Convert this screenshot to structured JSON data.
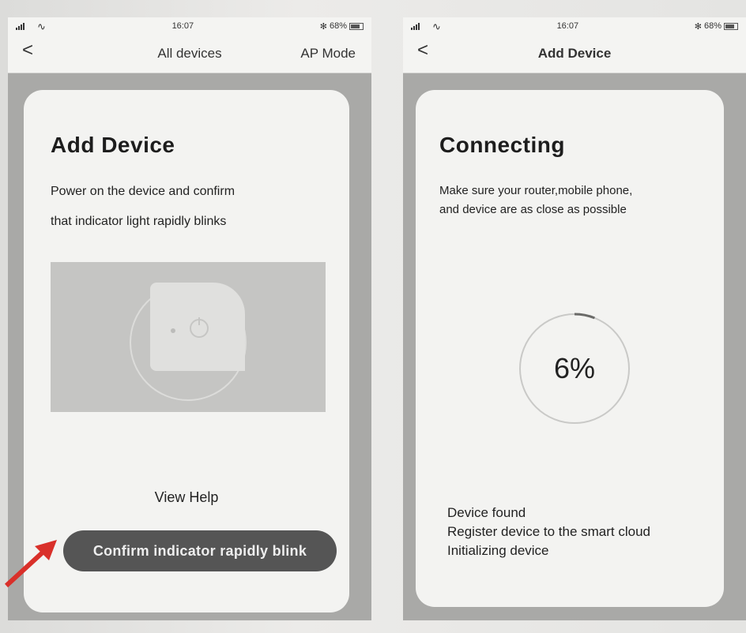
{
  "left_screen": {
    "status": {
      "time": "16:07",
      "battery": "68%"
    },
    "nav": {
      "back_label": "<",
      "title": "All devices",
      "right_action": "AP Mode"
    },
    "card": {
      "title": "Add Device",
      "description_line1": "Power on the device and confirm",
      "description_line2": "that indicator light rapidly blinks",
      "help_label": "View Help",
      "confirm_label": "Confirm indicator rapidly blink"
    }
  },
  "right_screen": {
    "status": {
      "time": "16:07",
      "battery": "68%"
    },
    "nav": {
      "back_label": "<",
      "title": "Add Device"
    },
    "card": {
      "title": "Connecting",
      "description_line1": "Make sure your router,mobile phone,",
      "description_line2": "and device are as close as possible",
      "progress_percent": 6,
      "progress_text": "6%",
      "steps": [
        "Device found",
        "Register device to the smart cloud",
        "Initializing device"
      ]
    }
  },
  "colors": {
    "card_bg": "#f3f3f1",
    "button_bg": "#555555",
    "arrow": "#d9302a"
  },
  "icons": [
    "back-icon",
    "signal-icon",
    "wifi-icon",
    "bluetooth-icon",
    "battery-icon",
    "power-icon",
    "red-arrow-icon"
  ]
}
